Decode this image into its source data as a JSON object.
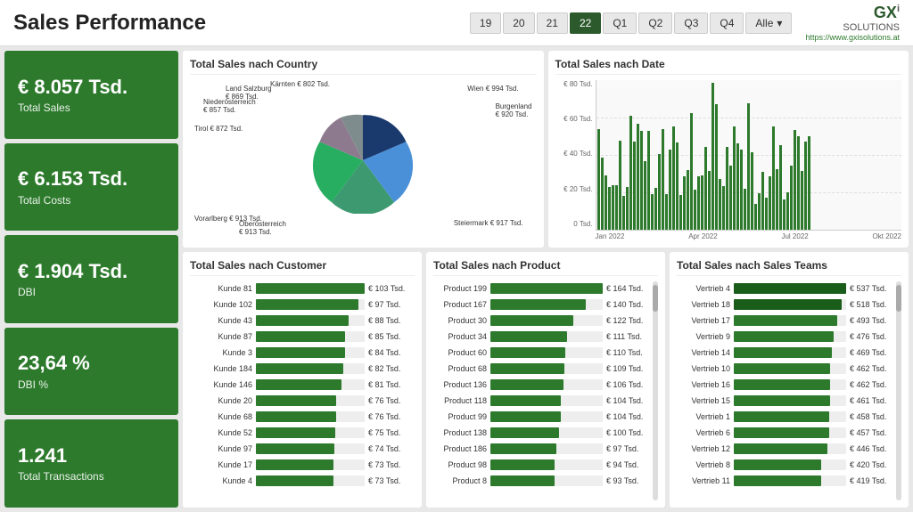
{
  "header": {
    "title": "Sales Performance",
    "year_buttons": [
      "19",
      "20",
      "21",
      "22"
    ],
    "active_year": "22",
    "quarter_buttons": [
      "Q1",
      "Q2",
      "Q3",
      "Q4"
    ],
    "alle_label": "Alle",
    "logo_text": "GX",
    "logo_super": "i",
    "logo_sub": "SOLUTIONS",
    "logo_url": "https://www.gxisolutions.at"
  },
  "kpis": [
    {
      "value": "€ 8.057 Tsd.",
      "label": "Total Sales"
    },
    {
      "value": "€ 6.153 Tsd.",
      "label": "Total Costs"
    },
    {
      "value": "€ 1.904 Tsd.",
      "label": "DBI"
    },
    {
      "value": "23,64 %",
      "label": "DBI %"
    },
    {
      "value": "1.241",
      "label": "Total Transactions"
    }
  ],
  "charts": {
    "country": {
      "title": "Total Sales nach Country",
      "segments": [
        {
          "label": "Wien € 994 Tsd.",
          "value": 994,
          "color": "#1a3a6e",
          "startAngle": 0,
          "endAngle": 70
        },
        {
          "label": "Burgenland € 920 Tsd.",
          "value": 920,
          "color": "#2e86ab",
          "startAngle": 70,
          "endAngle": 135
        },
        {
          "label": "Steiermark € 917 Tsd.",
          "value": 917,
          "color": "#3d9970",
          "startAngle": 135,
          "endAngle": 200
        },
        {
          "label": "Oberösterreich € 913 Tsd.",
          "value": 913,
          "color": "#27ae60",
          "startAngle": 200,
          "endAngle": 265
        },
        {
          "label": "Vorarlberg € 913 Tsd.",
          "value": 913,
          "color": "#8e44ad",
          "startAngle": 265,
          "endAngle": 310
        },
        {
          "label": "Tirol € 872 Tsd.",
          "value": 872,
          "color": "#7f8c8d",
          "startAngle": 310,
          "endAngle": 340
        },
        {
          "label": "Land Salzburg € 869 Tsd.",
          "value": 869,
          "color": "#2ecc71",
          "startAngle": 340,
          "endAngle": 360
        }
      ]
    },
    "date": {
      "title": "Total Sales nach Date",
      "y_labels": [
        "0 Tsd.",
        "€ 20 Tsd.",
        "€ 40 Tsd.",
        "€ 60 Tsd.",
        "€ 80 Tsd."
      ],
      "x_labels": [
        "Jan 2022",
        "Apr 2022",
        "Jul 2022",
        "Okt 2022"
      ]
    },
    "customer": {
      "title": "Total Sales nach Customer",
      "rows": [
        {
          "label": "Kunde 81",
          "value": "€ 103 Tsd.",
          "pct": 100
        },
        {
          "label": "Kunde 102",
          "value": "€ 97 Tsd.",
          "pct": 94
        },
        {
          "label": "Kunde 43",
          "value": "€ 88 Tsd.",
          "pct": 85
        },
        {
          "label": "Kunde 87",
          "value": "€ 85 Tsd.",
          "pct": 82
        },
        {
          "label": "Kunde 3",
          "value": "€ 84 Tsd.",
          "pct": 82
        },
        {
          "label": "Kunde 184",
          "value": "€ 82 Tsd.",
          "pct": 80
        },
        {
          "label": "Kunde 146",
          "value": "€ 81 Tsd.",
          "pct": 79
        },
        {
          "label": "Kunde 20",
          "value": "€ 76 Tsd.",
          "pct": 74
        },
        {
          "label": "Kunde 68",
          "value": "€ 76 Tsd.",
          "pct": 74
        },
        {
          "label": "Kunde 52",
          "value": "€ 75 Tsd.",
          "pct": 73
        },
        {
          "label": "Kunde 97",
          "value": "€ 74 Tsd.",
          "pct": 72
        },
        {
          "label": "Kunde 17",
          "value": "€ 73 Tsd.",
          "pct": 71
        },
        {
          "label": "Kunde 4",
          "value": "€ 73 Tsd.",
          "pct": 71
        }
      ]
    },
    "product": {
      "title": "Total Sales nach Product",
      "rows": [
        {
          "label": "Product 199",
          "value": "€ 164 Tsd.",
          "pct": 100
        },
        {
          "label": "Product 167",
          "value": "€ 140 Tsd.",
          "pct": 85
        },
        {
          "label": "Product 30",
          "value": "€ 122 Tsd.",
          "pct": 74
        },
        {
          "label": "Product 34",
          "value": "€ 111 Tsd.",
          "pct": 68
        },
        {
          "label": "Product 60",
          "value": "€ 110 Tsd.",
          "pct": 67
        },
        {
          "label": "Product 68",
          "value": "€ 109 Tsd.",
          "pct": 66
        },
        {
          "label": "Product 136",
          "value": "€ 106 Tsd.",
          "pct": 65
        },
        {
          "label": "Product 118",
          "value": "€ 104 Tsd.",
          "pct": 63
        },
        {
          "label": "Product 99",
          "value": "€ 104 Tsd.",
          "pct": 63
        },
        {
          "label": "Product 138",
          "value": "€ 100 Tsd.",
          "pct": 61
        },
        {
          "label": "Product 186",
          "value": "€ 97 Tsd.",
          "pct": 59
        },
        {
          "label": "Product 98",
          "value": "€ 94 Tsd.",
          "pct": 57
        },
        {
          "label": "Product 8",
          "value": "€ 93 Tsd.",
          "pct": 57
        }
      ]
    },
    "sales_teams": {
      "title": "Total Sales nach Sales Teams",
      "rows": [
        {
          "label": "Vertrieb 4",
          "value": "€ 537 Tsd.",
          "pct": 100
        },
        {
          "label": "Vertrieb 18",
          "value": "€ 518 Tsd.",
          "pct": 96
        },
        {
          "label": "Vertrieb 17",
          "value": "€ 493 Tsd.",
          "pct": 92
        },
        {
          "label": "Vertrieb 9",
          "value": "€ 476 Tsd.",
          "pct": 89
        },
        {
          "label": "Vertrieb 14",
          "value": "€ 469 Tsd.",
          "pct": 87
        },
        {
          "label": "Vertrieb 10",
          "value": "€ 462 Tsd.",
          "pct": 86
        },
        {
          "label": "Vertrieb 16",
          "value": "€ 462 Tsd.",
          "pct": 86
        },
        {
          "label": "Vertrieb 15",
          "value": "€ 461 Tsd.",
          "pct": 86
        },
        {
          "label": "Vertrieb 1",
          "value": "€ 458 Tsd.",
          "pct": 85
        },
        {
          "label": "Vertrieb 6",
          "value": "€ 457 Tsd.",
          "pct": 85
        },
        {
          "label": "Vertrieb 12",
          "value": "€ 446 Tsd.",
          "pct": 83
        },
        {
          "label": "Vertrieb 8",
          "value": "€ 420 Tsd.",
          "pct": 78
        },
        {
          "label": "Vertrieb 11",
          "value": "€ 419 Tsd.",
          "pct": 78
        }
      ]
    }
  }
}
